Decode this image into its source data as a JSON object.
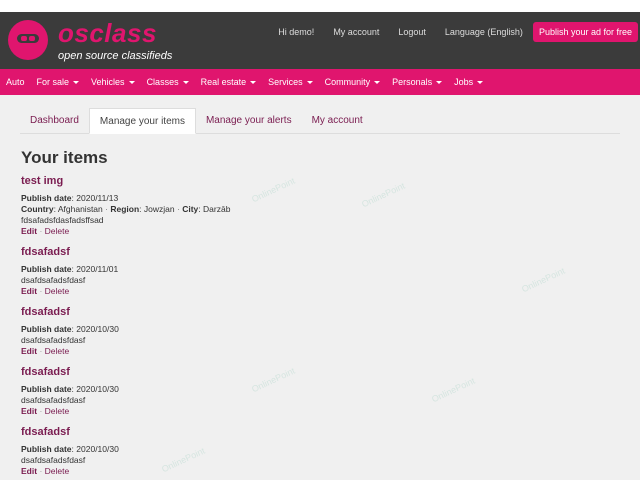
{
  "brand": {
    "name": "osclass",
    "tagline": "open source classifieds",
    "primary_color": "#e0156e",
    "header_bg": "#3b3b3b"
  },
  "top_nav": {
    "greeting": "Hi demo!",
    "my_account": "My account",
    "logout": "Logout",
    "language": "Language (English)",
    "publish": "Publish your ad for free"
  },
  "categories": [
    {
      "label": "Auto",
      "dropdown": false
    },
    {
      "label": "For sale",
      "dropdown": true
    },
    {
      "label": "Vehicles",
      "dropdown": true
    },
    {
      "label": "Classes",
      "dropdown": true
    },
    {
      "label": "Real estate",
      "dropdown": true
    },
    {
      "label": "Services",
      "dropdown": true
    },
    {
      "label": "Community",
      "dropdown": true
    },
    {
      "label": "Personals",
      "dropdown": true
    },
    {
      "label": "Jobs",
      "dropdown": true
    }
  ],
  "tabs": [
    {
      "label": "Dashboard",
      "active": false
    },
    {
      "label": "Manage your items",
      "active": true
    },
    {
      "label": "Manage your alerts",
      "active": false
    },
    {
      "label": "My account",
      "active": false
    }
  ],
  "page_title": "Your items",
  "labels": {
    "publish_date": "Publish date",
    "country": "Country",
    "region": "Region",
    "city": "City",
    "edit": "Edit",
    "delete": "Delete",
    "separator": "·"
  },
  "items": [
    {
      "title": "test img",
      "date": "2020/11/13",
      "country": "Afghanistan",
      "region": "Jowzjan",
      "city": "Darzāb",
      "description": "fdsafadsfdasfadsffsad"
    },
    {
      "title": "fdsafadsf",
      "date": "2020/11/01",
      "description": "dsafdsafadsfdasf"
    },
    {
      "title": "fdsafadsf",
      "date": "2020/10/30",
      "description": "dsafdsafadsfdasf"
    },
    {
      "title": "fdsafadsf",
      "date": "2020/10/30",
      "description": "dsafdsafadsfdasf"
    },
    {
      "title": "fdsafadsf",
      "date": "2020/10/30",
      "description": "dsafdsafadsfdasf"
    }
  ],
  "watermark": "OnlinePoint"
}
